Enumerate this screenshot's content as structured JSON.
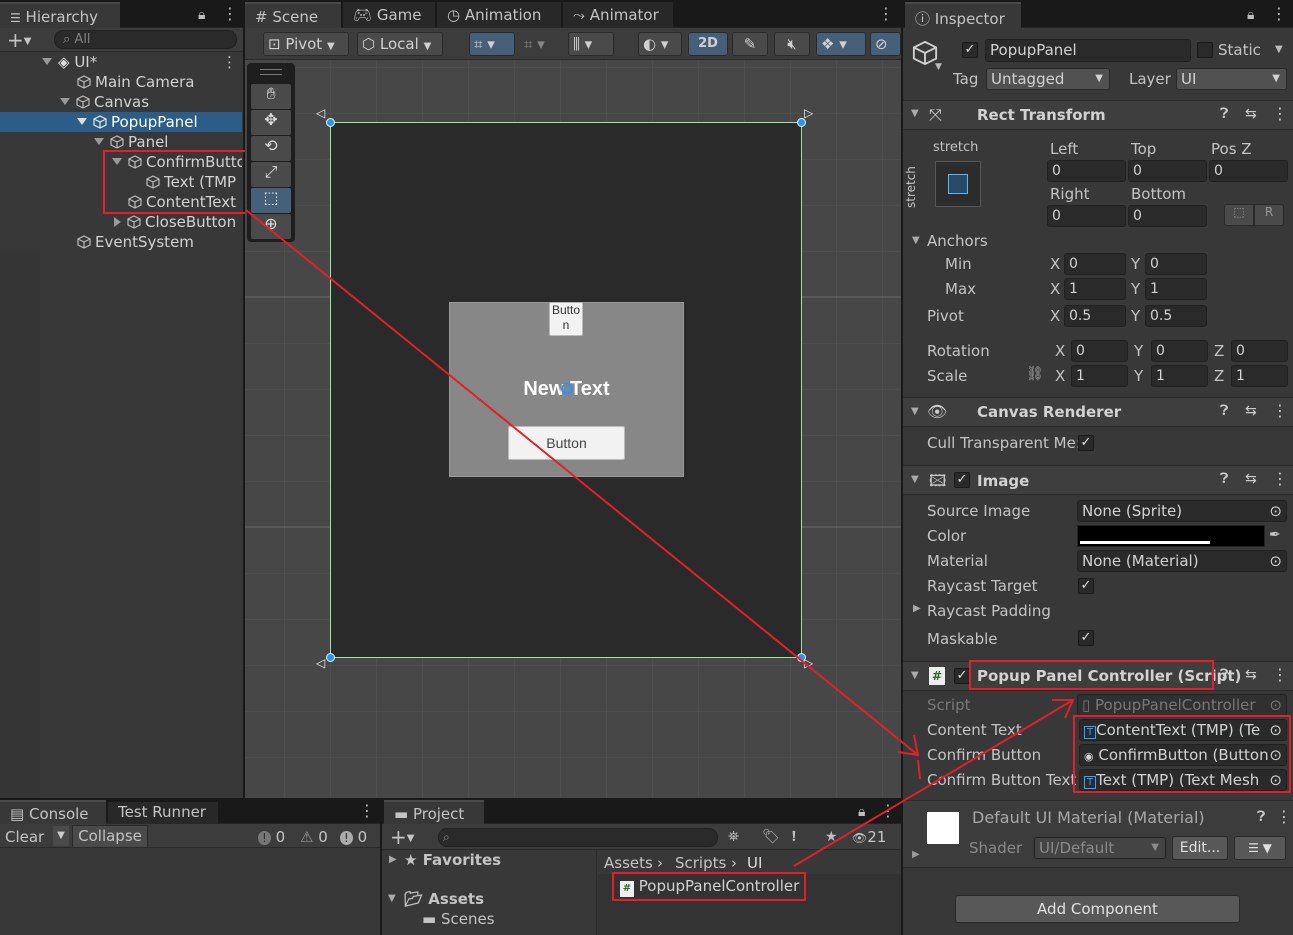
{
  "hierarchy": {
    "tab_label": "Hierarchy",
    "search_placeholder": "All",
    "rows": [
      {
        "label": "UI*",
        "indent": 0
      },
      {
        "label": "Main Camera",
        "indent": 1
      },
      {
        "label": "Canvas",
        "indent": 1
      },
      {
        "label": "PopupPanel",
        "indent": 2
      },
      {
        "label": "Panel",
        "indent": 3
      },
      {
        "label": "ConfirmButto",
        "indent": 4
      },
      {
        "label": "Text (TMP",
        "indent": 5
      },
      {
        "label": "ContentText",
        "indent": 4
      },
      {
        "label": "CloseButton",
        "indent": 4
      },
      {
        "label": "EventSystem",
        "indent": 1
      }
    ]
  },
  "scene": {
    "tabs": [
      "Scene",
      "Game",
      "Animation",
      "Animator"
    ],
    "pivot_label": "Pivot",
    "local_label": "Local",
    "mode_2d": "2D",
    "popup": {
      "top_button": "Butto\nn",
      "top_button_l1": "Butto",
      "top_button_l2": "n",
      "content_text": "New Text",
      "bottom_button": "Button"
    }
  },
  "inspector": {
    "tab_label": "Inspector",
    "object_name": "PopupPanel",
    "static_label": "Static",
    "tag_label": "Tag",
    "tag_value": "Untagged",
    "layer_label": "Layer",
    "layer_value": "UI",
    "rect_transform": {
      "title": "Rect Transform",
      "stretch_top": "stretch",
      "stretch_side": "stretch",
      "left_label": "Left",
      "left": "0",
      "top_label": "Top",
      "top": "0",
      "posz_label": "Pos Z",
      "posz": "0",
      "right_label": "Right",
      "right": "0",
      "bottom_label": "Bottom",
      "bottom": "0",
      "anchors_label": "Anchors",
      "min_label": "Min",
      "min_x": "0",
      "min_y": "0",
      "max_label": "Max",
      "max_x": "1",
      "max_y": "1",
      "pivot_label": "Pivot",
      "pivot_x": "0.5",
      "pivot_y": "0.5",
      "rotation_label": "Rotation",
      "rot_x": "0",
      "rot_y": "0",
      "rot_z": "0",
      "scale_label": "Scale",
      "scale_x": "1",
      "scale_y": "1",
      "scale_z": "1"
    },
    "canvas_renderer": {
      "title": "Canvas Renderer",
      "cull_label": "Cull Transparent Me:"
    },
    "image": {
      "title": "Image",
      "source_label": "Source Image",
      "source_value": "None (Sprite)",
      "color_label": "Color",
      "material_label": "Material",
      "material_value": "None (Material)",
      "raycast_target_label": "Raycast Target",
      "raycast_padding_label": "Raycast Padding",
      "maskable_label": "Maskable"
    },
    "script": {
      "title": "Popup Panel Controller (Script)",
      "script_label": "Script",
      "script_value": "PopupPanelController",
      "content_label": "Content Text",
      "content_value": "ContentText (TMP) (Te",
      "confirm_label": "Confirm Button",
      "confirm_value": "ConfirmButton (Button)",
      "confirm_text_label": "Confirm Button Text",
      "confirm_text_value": "Text (TMP) (Text Mesh"
    },
    "material": {
      "title": "Default UI Material (Material)",
      "shader_label": "Shader",
      "shader_value": "UI/Default",
      "edit_label": "Edit..."
    },
    "add_component": "Add Component"
  },
  "console": {
    "tabs": [
      "Console",
      "Test Runner"
    ],
    "clear": "Clear",
    "collapse": "Collapse",
    "counts": [
      "0",
      "0",
      "0"
    ]
  },
  "project": {
    "tab_label": "Project",
    "favorites": "Favorites",
    "assets": "Assets",
    "scenes": "Scenes",
    "breadcrumb": [
      "Assets",
      "Scripts",
      "UI"
    ],
    "file": "PopupPanelController",
    "count": "21"
  },
  "colors": {
    "annotation_red": "#e0202a",
    "selection_blue": "#2c5d87",
    "handle_blue": "#3a8ee6"
  }
}
